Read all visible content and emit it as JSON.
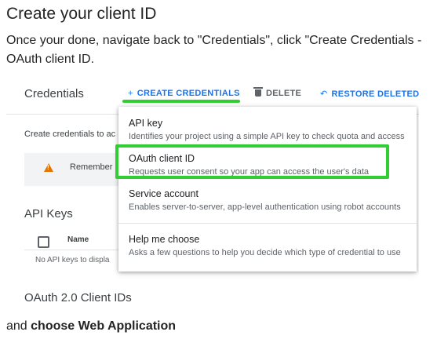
{
  "heading": "Create your client ID",
  "paragraph": "Once your done, navigate back to \"Credentials\", click \"Create Credentials - OAuth client ID.",
  "footer": {
    "prefix": "and ",
    "bold": "choose Web Application"
  },
  "screenshot": {
    "title": "Credentials",
    "actions": {
      "create": "CREATE CREDENTIALS",
      "delete": "DELETE",
      "restore": "RESTORE DELETED"
    },
    "left_text": "Create credentials to ac",
    "remember": "Remember",
    "api_keys_heading": "API Keys",
    "table_col_name": "Name",
    "no_keys": "No API keys to displa",
    "oauth_heading": "OAuth 2.0 Client IDs",
    "menu": [
      {
        "title": "API key",
        "desc": "Identifies your project using a simple API key to check quota and access"
      },
      {
        "title": "OAuth client ID",
        "desc": "Requests user consent so your app can access the user's data"
      },
      {
        "title": "Service account",
        "desc": "Enables server-to-server, app-level authentication using robot accounts"
      },
      {
        "title": "Help me choose",
        "desc": "Asks a few questions to help you decide which type of credential to use"
      }
    ]
  },
  "colors": {
    "accent": "#1a73e8",
    "highlight": "#32cd32",
    "warning": "#e37400"
  }
}
